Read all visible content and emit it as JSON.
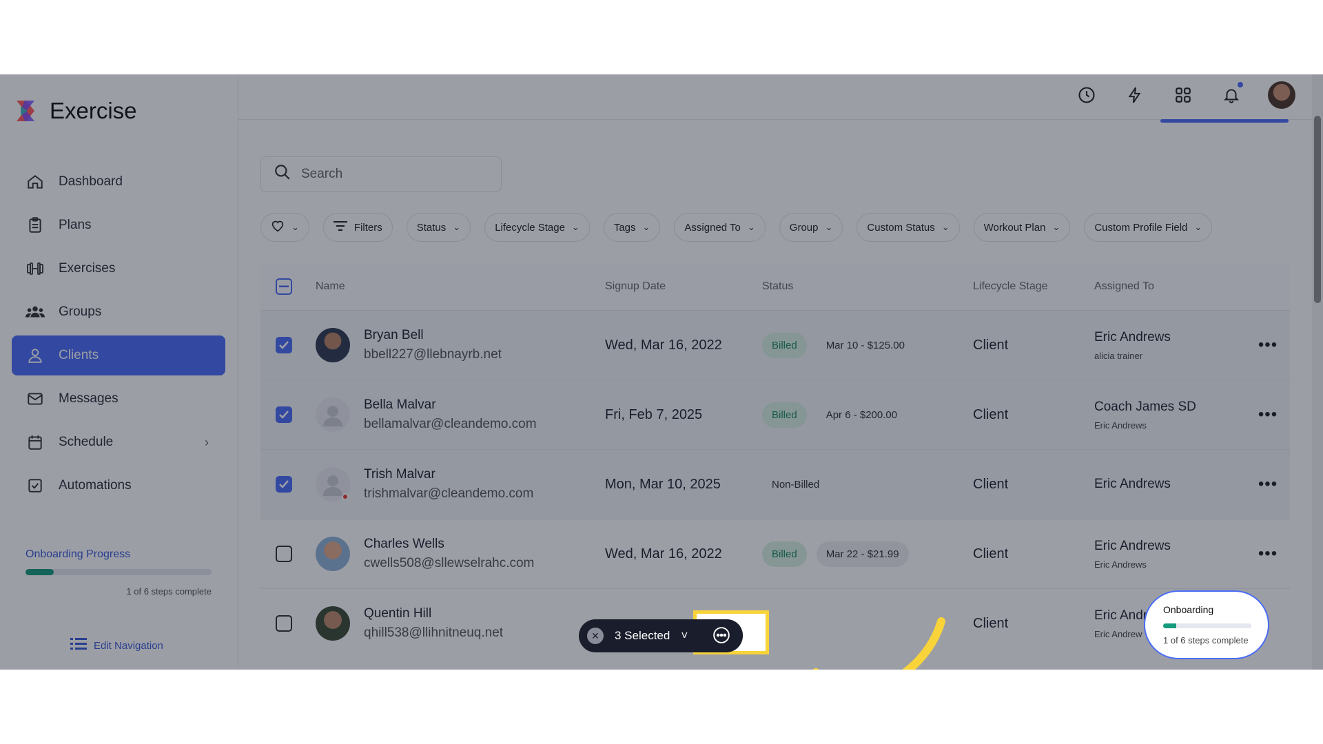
{
  "app": {
    "name": "Exercise"
  },
  "sidebar": {
    "items": [
      {
        "label": "Dashboard",
        "icon": "home-icon"
      },
      {
        "label": "Plans",
        "icon": "clipboard-icon"
      },
      {
        "label": "Exercises",
        "icon": "dumbbell-icon"
      },
      {
        "label": "Groups",
        "icon": "users-icon"
      },
      {
        "label": "Clients",
        "icon": "user-icon",
        "active": true
      },
      {
        "label": "Messages",
        "icon": "mail-icon"
      },
      {
        "label": "Schedule",
        "icon": "calendar-icon",
        "chevron": "›"
      },
      {
        "label": "Automations",
        "icon": "checkbox-icon"
      }
    ],
    "onboarding": {
      "title": "Onboarding Progress",
      "progress": 0.15,
      "sub": "1 of 6 steps complete"
    },
    "edit_nav": "Edit Navigation"
  },
  "search": {
    "placeholder": "Search"
  },
  "filters": [
    "Filters",
    "Status",
    "Lifecycle Stage",
    "Tags",
    "Assigned To",
    "Group",
    "Custom Status",
    "Workout Plan",
    "Custom Profile Field"
  ],
  "table": {
    "headers": [
      "Name",
      "Signup Date",
      "Status",
      "Lifecycle Stage",
      "Assigned To"
    ],
    "rows": [
      {
        "name": "Bryan Bell",
        "email": "bbell227@llebnayrb.net",
        "date": "Wed, Mar 16, 2022",
        "badge": "Billed",
        "billing": "Mar 10 - $125.00",
        "stage": "Client",
        "assigned": "Eric Andrews",
        "assigned2": "alicia trainer",
        "selected": true
      },
      {
        "name": "Bella Malvar",
        "email": "bellamalvar@cleandemo.com",
        "date": "Fri, Feb 7, 2025",
        "badge": "Billed",
        "billing": "Apr 6 - $200.00",
        "stage": "Client",
        "assigned": "Coach James SD",
        "assigned2": "Eric Andrews",
        "selected": true
      },
      {
        "name": "Trish Malvar",
        "email": "trishmalvar@cleandemo.com",
        "date": "Mon, Mar 10, 2025",
        "badge": "",
        "billing": "Non-Billed",
        "stage": "Client",
        "assigned": "Eric Andrews",
        "assigned2": "",
        "selected": true
      },
      {
        "name": "Charles Wells",
        "email": "cwells508@sllewselrahc.com",
        "date": "Wed, Mar 16, 2022",
        "badge": "Billed",
        "billing": "Mar 22 - $21.99",
        "stage": "Client",
        "assigned": "Eric Andrews",
        "assigned2": "Eric Andrews",
        "selected": false
      },
      {
        "name": "Quentin Hill",
        "email": "qhill538@llihnitneuq.net",
        "date": "",
        "badge": "",
        "billing": "",
        "stage": "Client",
        "assigned": "Eric Andr",
        "assigned2": "Eric Andrew",
        "selected": false
      }
    ]
  },
  "action_bar": {
    "selected": "3 Selected",
    "chevron": "˅"
  },
  "onboarding_float": {
    "title": "Onboarding",
    "progress": 0.15,
    "sub": "1 of 6 steps complete"
  },
  "colors": {
    "accent": "#4a6cf7",
    "highlight": "#f8d43a",
    "success": "#159b7e"
  }
}
